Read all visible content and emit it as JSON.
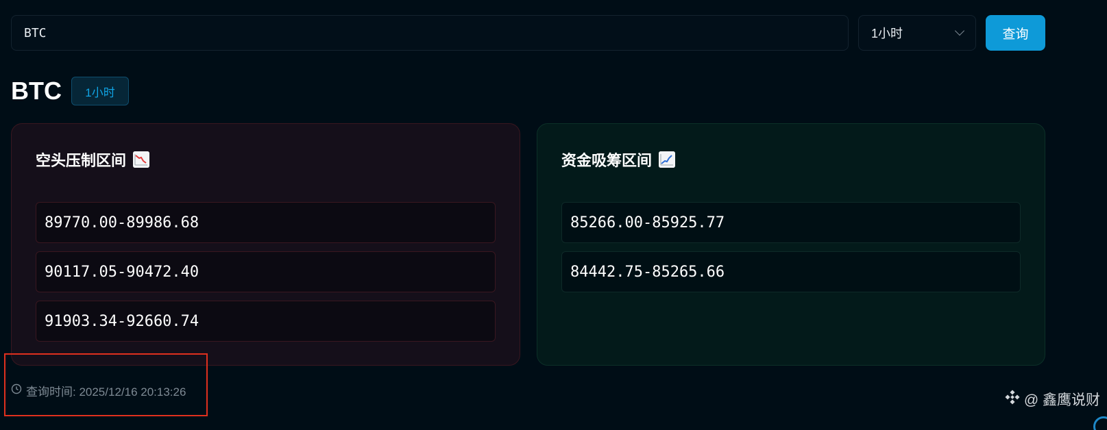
{
  "search": {
    "value": "BTC"
  },
  "period_select": {
    "selected": "1小时"
  },
  "query_button": {
    "label": "查询"
  },
  "result": {
    "symbol": "BTC",
    "period_badge": "1小时"
  },
  "cards": {
    "short": {
      "title": "空头压制区间",
      "icon": "chart-decreasing-icon",
      "accent": "#ef4444",
      "ranges": [
        "89770.00-89986.68",
        "90117.05-90472.40",
        "91903.34-92660.74"
      ]
    },
    "long": {
      "title": "资金吸筹区间",
      "icon": "chart-increasing-icon",
      "accent": "#10b981",
      "ranges": [
        "85266.00-85925.77",
        "84442.75-85265.66"
      ]
    }
  },
  "footer": {
    "query_time": "查询时间: 2025/12/16 20:13:26"
  },
  "watermark": {
    "text": "@ 鑫鹰说财"
  },
  "colors": {
    "background": "#000d16",
    "button": "#0e9ad8",
    "highlight": "#e0301e"
  }
}
